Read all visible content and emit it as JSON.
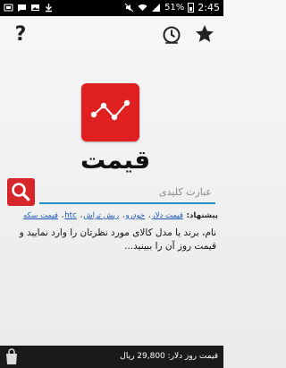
{
  "status_bar": {
    "time": "2:45",
    "battery": "51%"
  },
  "action_bar": {
    "help_icon": "question-mark-icon",
    "history_icon": "clock-history-icon",
    "favorites_icon": "star-icon"
  },
  "app": {
    "name": "قیمت",
    "logo_icon": "chart-line-icon"
  },
  "search": {
    "placeholder": "عبارت کلیدی",
    "button_icon": "search-icon"
  },
  "suggestions": {
    "label": "پیشنهاد:",
    "items": [
      "قیمت دلار",
      "خودرو",
      "ریش تراش",
      "htc",
      "قیمت سکه"
    ]
  },
  "description": "نام، برند یا مدل کالای مورد نظرتان را وارد نمایید و قیمت روز آن را ببینید...",
  "footer": {
    "rate_text": "قیمت روز دلار: 29,800 ریال"
  },
  "colors": {
    "brand_red": "#e02020",
    "search_underline": "#1d92c9",
    "link_blue": "#1a57b4"
  }
}
